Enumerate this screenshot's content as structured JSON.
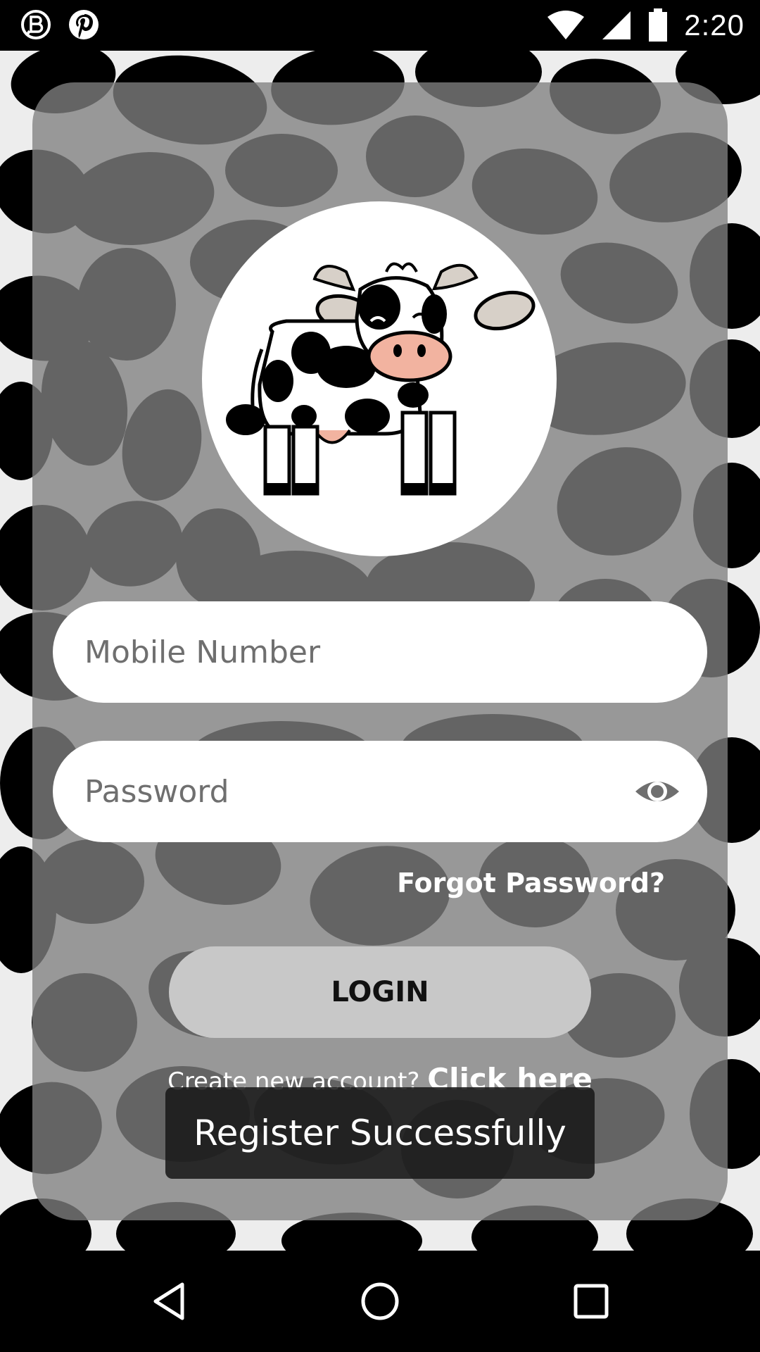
{
  "status_bar": {
    "time": "2:20",
    "left_icons": [
      "b-badge-icon",
      "pinterest-icon"
    ],
    "right_icons": [
      "wifi-icon",
      "signal-icon",
      "battery-icon"
    ]
  },
  "login": {
    "mobile_placeholder": "Mobile Number",
    "password_placeholder": "Password",
    "forgot_label": "Forgot Password?",
    "login_label": "LOGIN",
    "register_prompt": "Create new account?",
    "register_link": "Click here"
  },
  "toast": {
    "message": "Register Successfully"
  },
  "nav_bar": {
    "icons": [
      "back-icon",
      "home-icon",
      "recents-icon"
    ]
  },
  "colors": {
    "background": "#ededed",
    "spots": "#000000",
    "card": "#808080",
    "field": "#ffffff",
    "button": "#c8c8c8",
    "cow_nose": "#f2b3a0",
    "cow_horns": "#d7d0c8"
  }
}
